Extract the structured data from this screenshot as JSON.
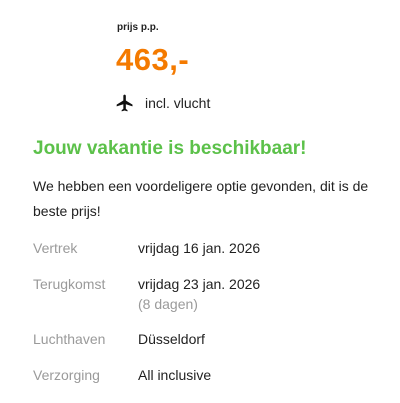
{
  "price": {
    "label": "prijs p.p.",
    "value": "463,-",
    "color": "#f47a00"
  },
  "flight": {
    "icon": "airplane-icon",
    "text": "incl. vlucht"
  },
  "availability": {
    "headline": "Jouw vakantie is beschikbaar!",
    "headline_color": "#5cc14a",
    "description": "We hebben een voordeligere optie gevonden, dit is de beste prijs!"
  },
  "details": [
    {
      "label": "Vertrek",
      "value": "vrijdag 16 jan. 2026"
    },
    {
      "label": "Terugkomst",
      "value": "vrijdag 23 jan. 2026",
      "sub": "(8 dagen)"
    },
    {
      "label": "Luchthaven",
      "value": "Düsseldorf"
    },
    {
      "label": "Verzorging",
      "value": "All inclusive"
    }
  ]
}
